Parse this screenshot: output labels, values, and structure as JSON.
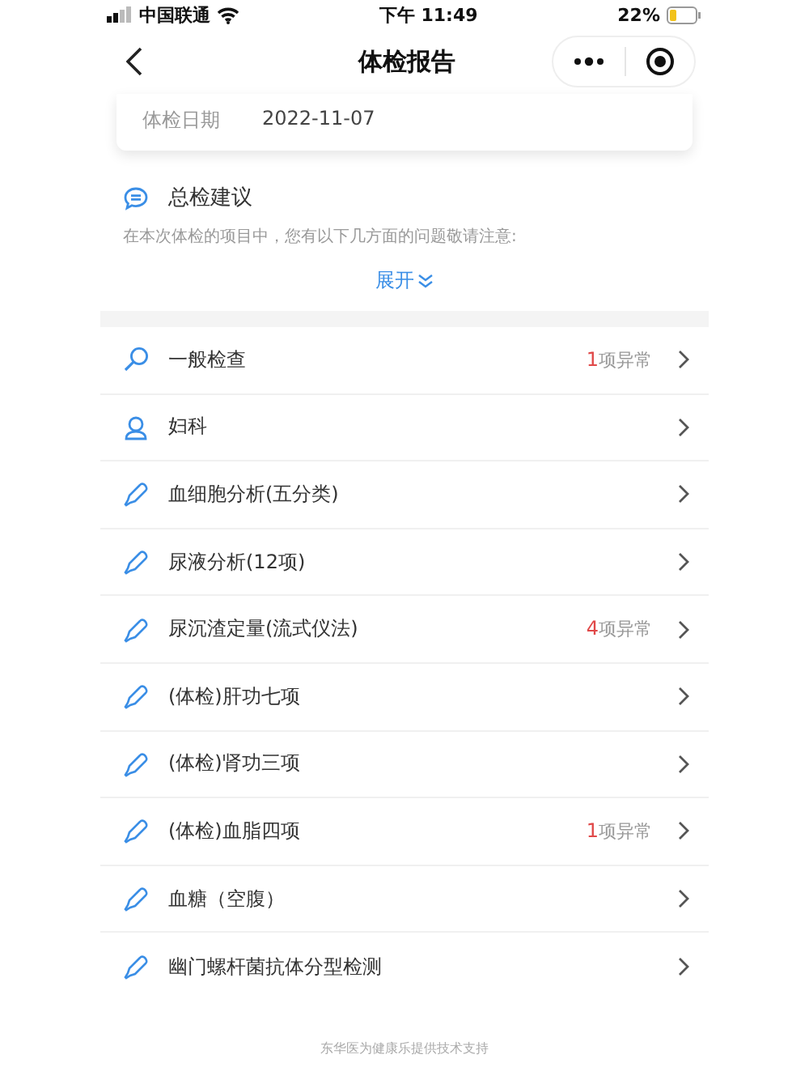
{
  "status_bar": {
    "carrier": "中国联通",
    "time": "下午 11:49",
    "battery": "22%"
  },
  "nav": {
    "title": "体检报告"
  },
  "info_card": {
    "label": "体检日期",
    "value": "2022-11-07"
  },
  "advice": {
    "title": "总检建议",
    "text": "在本次体检的项目中，您有以下几方面的问题敬请注意:",
    "expand": "展开"
  },
  "items": [
    {
      "kind": "search",
      "name": "一般检查",
      "abnormal_count": "1",
      "abnormal_label": "项异常"
    },
    {
      "kind": "person",
      "name": "妇科"
    },
    {
      "kind": "pipette",
      "name": "血细胞分析(五分类)"
    },
    {
      "kind": "pipette",
      "name": "尿液分析(12项)"
    },
    {
      "kind": "pipette",
      "name": "尿沉渣定量(流式仪法)",
      "abnormal_count": "4",
      "abnormal_label": "项异常"
    },
    {
      "kind": "pipette",
      "name": "(体检)肝功七项"
    },
    {
      "kind": "pipette",
      "name": "(体检)肾功三项"
    },
    {
      "kind": "pipette",
      "name": "(体检)血脂四项",
      "abnormal_count": "1",
      "abnormal_label": "项异常"
    },
    {
      "kind": "pipette",
      "name": "血糖（空腹）"
    },
    {
      "kind": "pipette",
      "name": "幽门螺杆菌抗体分型检测"
    }
  ],
  "footer": "东华医为健康乐提供技术支持"
}
